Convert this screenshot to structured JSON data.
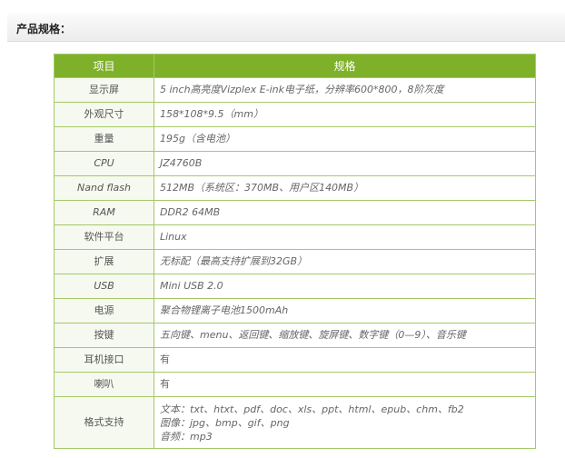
{
  "header": {
    "title": "产品规格："
  },
  "table": {
    "columns": [
      "项目",
      "规格"
    ],
    "rows": [
      {
        "label": "显示屏",
        "value": "5 inch高亮度Vizplex E-ink电子纸，分辨率600*800，8阶灰度"
      },
      {
        "label": "外观尺寸",
        "value": "158*108*9.5（mm）"
      },
      {
        "label": "重量",
        "value": "195g（含电池）"
      },
      {
        "label": "CPU",
        "value": "JZ4760B"
      },
      {
        "label": "Nand flash",
        "value": "512MB（系统区：370MB、用户区140MB）"
      },
      {
        "label": "RAM",
        "value": "DDR2 64MB"
      },
      {
        "label": "软件平台",
        "value": "Linux"
      },
      {
        "label": "扩展",
        "value": "无标配（最高支持扩展到32GB）"
      },
      {
        "label": "USB",
        "value": "Mini USB 2.0"
      },
      {
        "label": "电源",
        "value": "聚合物锂离子电池1500mAh"
      },
      {
        "label": "按键",
        "value": "五向键、menu、返回键、缩放键、旋屏键、数字键（0—9）、音乐键"
      },
      {
        "label": "耳机接口",
        "value": "有"
      },
      {
        "label": "喇叭",
        "value": "有"
      }
    ],
    "formats": {
      "label": "格式支持",
      "lines": [
        "文本：txt、htxt、pdf、doc、xls、ppt、html、epub、chm、fb2",
        "图像：jpg、bmp、gif、png",
        "音频：mp3"
      ]
    }
  },
  "colors": {
    "header_green": "#7fb02a",
    "border_green": "#a6c86a",
    "label_bg": "#f6f9ef"
  }
}
